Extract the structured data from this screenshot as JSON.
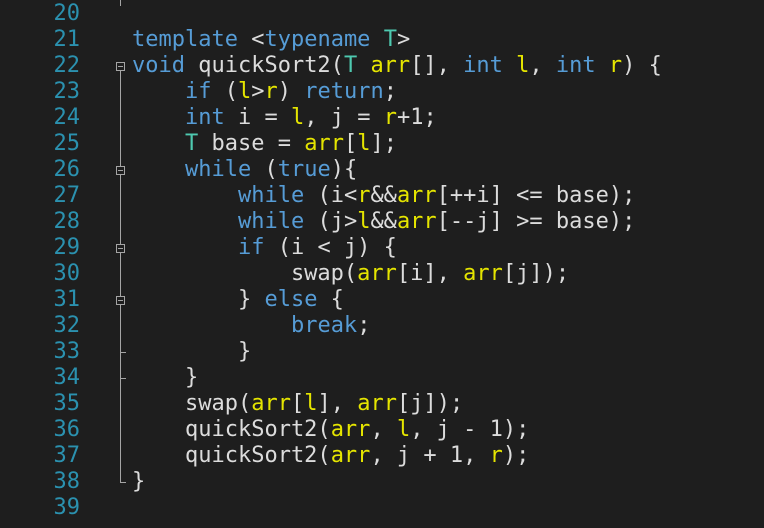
{
  "editor": {
    "background": "#1e1e1e",
    "line_number_color": "#2b91af",
    "lines": [
      {
        "num": "20",
        "tokens": []
      },
      {
        "num": "21",
        "tokens": [
          {
            "t": "template",
            "c": "kw"
          },
          {
            "t": " <",
            "c": "txt"
          },
          {
            "t": "typename",
            "c": "kw"
          },
          {
            "t": " ",
            "c": "txt"
          },
          {
            "t": "T",
            "c": "ty"
          },
          {
            "t": ">",
            "c": "txt"
          }
        ]
      },
      {
        "num": "22",
        "tokens": [
          {
            "t": "void",
            "c": "kw"
          },
          {
            "t": " quickSort2(",
            "c": "txt"
          },
          {
            "t": "T",
            "c": "ty"
          },
          {
            "t": " ",
            "c": "txt"
          },
          {
            "t": "arr",
            "c": "pm"
          },
          {
            "t": "[], ",
            "c": "txt"
          },
          {
            "t": "int",
            "c": "kw"
          },
          {
            "t": " ",
            "c": "txt"
          },
          {
            "t": "l",
            "c": "pm"
          },
          {
            "t": ", ",
            "c": "txt"
          },
          {
            "t": "int",
            "c": "kw"
          },
          {
            "t": " ",
            "c": "txt"
          },
          {
            "t": "r",
            "c": "pm"
          },
          {
            "t": ") {",
            "c": "txt"
          }
        ]
      },
      {
        "num": "23",
        "tokens": [
          {
            "t": "    ",
            "c": "txt"
          },
          {
            "t": "if",
            "c": "kw"
          },
          {
            "t": " (",
            "c": "txt"
          },
          {
            "t": "l",
            "c": "pm"
          },
          {
            "t": ">",
            "c": "txt"
          },
          {
            "t": "r",
            "c": "pm"
          },
          {
            "t": ") ",
            "c": "txt"
          },
          {
            "t": "return",
            "c": "kw"
          },
          {
            "t": ";",
            "c": "txt"
          }
        ]
      },
      {
        "num": "24",
        "tokens": [
          {
            "t": "    ",
            "c": "txt"
          },
          {
            "t": "int",
            "c": "kw"
          },
          {
            "t": " i = ",
            "c": "txt"
          },
          {
            "t": "l",
            "c": "pm"
          },
          {
            "t": ", j = ",
            "c": "txt"
          },
          {
            "t": "r",
            "c": "pm"
          },
          {
            "t": "+1;",
            "c": "txt"
          }
        ]
      },
      {
        "num": "25",
        "tokens": [
          {
            "t": "    ",
            "c": "txt"
          },
          {
            "t": "T",
            "c": "ty"
          },
          {
            "t": " base = ",
            "c": "txt"
          },
          {
            "t": "arr",
            "c": "pm"
          },
          {
            "t": "[",
            "c": "txt"
          },
          {
            "t": "l",
            "c": "pm"
          },
          {
            "t": "];",
            "c": "txt"
          }
        ]
      },
      {
        "num": "26",
        "tokens": [
          {
            "t": "    ",
            "c": "txt"
          },
          {
            "t": "while",
            "c": "kw"
          },
          {
            "t": " (",
            "c": "txt"
          },
          {
            "t": "true",
            "c": "kw"
          },
          {
            "t": "){",
            "c": "txt"
          }
        ]
      },
      {
        "num": "27",
        "tokens": [
          {
            "t": "        ",
            "c": "txt"
          },
          {
            "t": "while",
            "c": "kw"
          },
          {
            "t": " (i<",
            "c": "txt"
          },
          {
            "t": "r",
            "c": "pm"
          },
          {
            "t": "&&",
            "c": "txt"
          },
          {
            "t": "arr",
            "c": "pm"
          },
          {
            "t": "[++i] <= base);",
            "c": "txt"
          }
        ]
      },
      {
        "num": "28",
        "tokens": [
          {
            "t": "        ",
            "c": "txt"
          },
          {
            "t": "while",
            "c": "kw"
          },
          {
            "t": " (j>",
            "c": "txt"
          },
          {
            "t": "l",
            "c": "pm"
          },
          {
            "t": "&&",
            "c": "txt"
          },
          {
            "t": "arr",
            "c": "pm"
          },
          {
            "t": "[--j] >= base);",
            "c": "txt"
          }
        ]
      },
      {
        "num": "29",
        "tokens": [
          {
            "t": "        ",
            "c": "txt"
          },
          {
            "t": "if",
            "c": "kw"
          },
          {
            "t": " (i < j) {",
            "c": "txt"
          }
        ]
      },
      {
        "num": "30",
        "tokens": [
          {
            "t": "            swap(",
            "c": "txt"
          },
          {
            "t": "arr",
            "c": "pm"
          },
          {
            "t": "[i], ",
            "c": "txt"
          },
          {
            "t": "arr",
            "c": "pm"
          },
          {
            "t": "[j]);",
            "c": "txt"
          }
        ]
      },
      {
        "num": "31",
        "tokens": [
          {
            "t": "        } ",
            "c": "txt"
          },
          {
            "t": "else",
            "c": "kw"
          },
          {
            "t": " {",
            "c": "txt"
          }
        ]
      },
      {
        "num": "32",
        "tokens": [
          {
            "t": "            ",
            "c": "txt"
          },
          {
            "t": "break",
            "c": "kw"
          },
          {
            "t": ";",
            "c": "txt"
          }
        ]
      },
      {
        "num": "33",
        "tokens": [
          {
            "t": "        }",
            "c": "txt"
          }
        ]
      },
      {
        "num": "34",
        "tokens": [
          {
            "t": "    }",
            "c": "txt"
          }
        ]
      },
      {
        "num": "35",
        "tokens": [
          {
            "t": "    swap(",
            "c": "txt"
          },
          {
            "t": "arr",
            "c": "pm"
          },
          {
            "t": "[",
            "c": "txt"
          },
          {
            "t": "l",
            "c": "pm"
          },
          {
            "t": "], ",
            "c": "txt"
          },
          {
            "t": "arr",
            "c": "pm"
          },
          {
            "t": "[j]);",
            "c": "txt"
          }
        ]
      },
      {
        "num": "36",
        "tokens": [
          {
            "t": "    quickSort2(",
            "c": "txt"
          },
          {
            "t": "arr",
            "c": "pm"
          },
          {
            "t": ", ",
            "c": "txt"
          },
          {
            "t": "l",
            "c": "pm"
          },
          {
            "t": ", j - 1);",
            "c": "txt"
          }
        ]
      },
      {
        "num": "37",
        "tokens": [
          {
            "t": "    quickSort2(",
            "c": "txt"
          },
          {
            "t": "arr",
            "c": "pm"
          },
          {
            "t": ", j + 1, ",
            "c": "txt"
          },
          {
            "t": "r",
            "c": "pm"
          },
          {
            "t": ");",
            "c": "txt"
          }
        ]
      },
      {
        "num": "38",
        "tokens": [
          {
            "t": "}",
            "c": "txt"
          }
        ]
      },
      {
        "num": "39",
        "tokens": []
      }
    ]
  }
}
